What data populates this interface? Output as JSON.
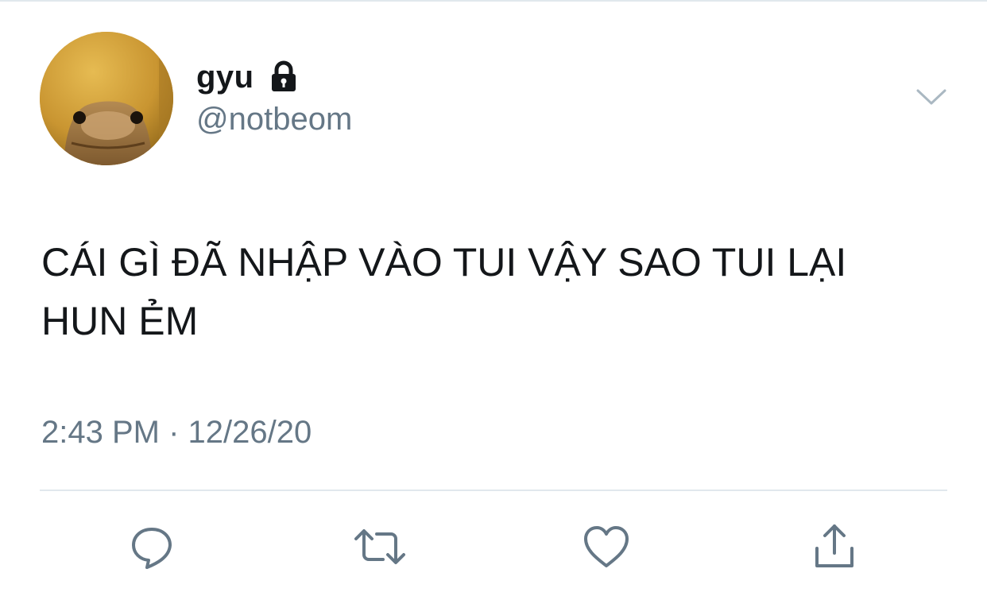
{
  "tweet": {
    "author": {
      "display_name": "gyu",
      "handle": "@notbeom",
      "protected_icon": "lock-icon",
      "avatar": "lizard-avatar"
    },
    "text": "CÁI GÌ ĐÃ NHẬP VÀO TUI VẬY SAO TUI LẠI HUN ẺM",
    "timestamp": "2:43 PM · 12/26/20",
    "menu_icon": "chevron-down-icon",
    "actions": [
      {
        "name": "reply",
        "icon": "speech-bubble-icon"
      },
      {
        "name": "retweet",
        "icon": "retweet-icon"
      },
      {
        "name": "like",
        "icon": "heart-icon"
      },
      {
        "name": "share",
        "icon": "share-icon"
      }
    ]
  },
  "colors": {
    "text_primary": "#14171a",
    "text_secondary": "#657786",
    "icon": "#657786",
    "border": "#e1e8ed",
    "background": "#ffffff"
  }
}
